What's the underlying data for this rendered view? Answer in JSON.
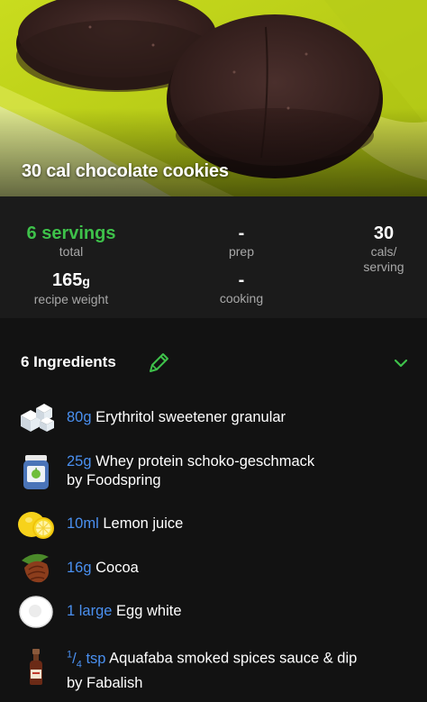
{
  "recipe": {
    "title": "30 cal chocolate cookies"
  },
  "stats": {
    "servings_value": "6 servings",
    "servings_label": "total",
    "prep_value": "-",
    "prep_label": "prep",
    "cals_value": "30",
    "cals_label_line1": "cals/",
    "cals_label_line2": "serving",
    "weight_value": "165",
    "weight_unit": "g",
    "weight_label": "recipe weight",
    "cooking_value": "-",
    "cooking_label": "cooking"
  },
  "ingredients_header": {
    "title": "6 Ingredients",
    "edit_icon": "pencil-icon",
    "toggle_icon": "chevron-down-icon"
  },
  "ingredients": [
    {
      "qty": "80g",
      "name": "Erythritol sweetener granular",
      "icon": "sugar-cubes-icon"
    },
    {
      "qty": "25g",
      "name": "Whey protein schoko-geschmack",
      "name_line2": "by Foodspring",
      "icon": "protein-jar-icon"
    },
    {
      "qty": "10ml",
      "name": "Lemon juice",
      "icon": "lemon-icon"
    },
    {
      "qty": "16g",
      "name": "Cocoa",
      "icon": "cocoa-pod-icon"
    },
    {
      "qty": "1 large",
      "name": "Egg white",
      "icon": "egg-icon"
    },
    {
      "qty_num": "1",
      "qty_den": "4",
      "qty_unit": "tsp",
      "name": "Aquafaba smoked spices sauce & dip",
      "name_line2": "by Fabalish",
      "icon": "sauce-bottle-icon"
    }
  ],
  "colors": {
    "accent_green": "#3ec14a",
    "quantity_blue": "#4a90f0",
    "background": "#121212",
    "stats_background": "#1b1b1b"
  }
}
